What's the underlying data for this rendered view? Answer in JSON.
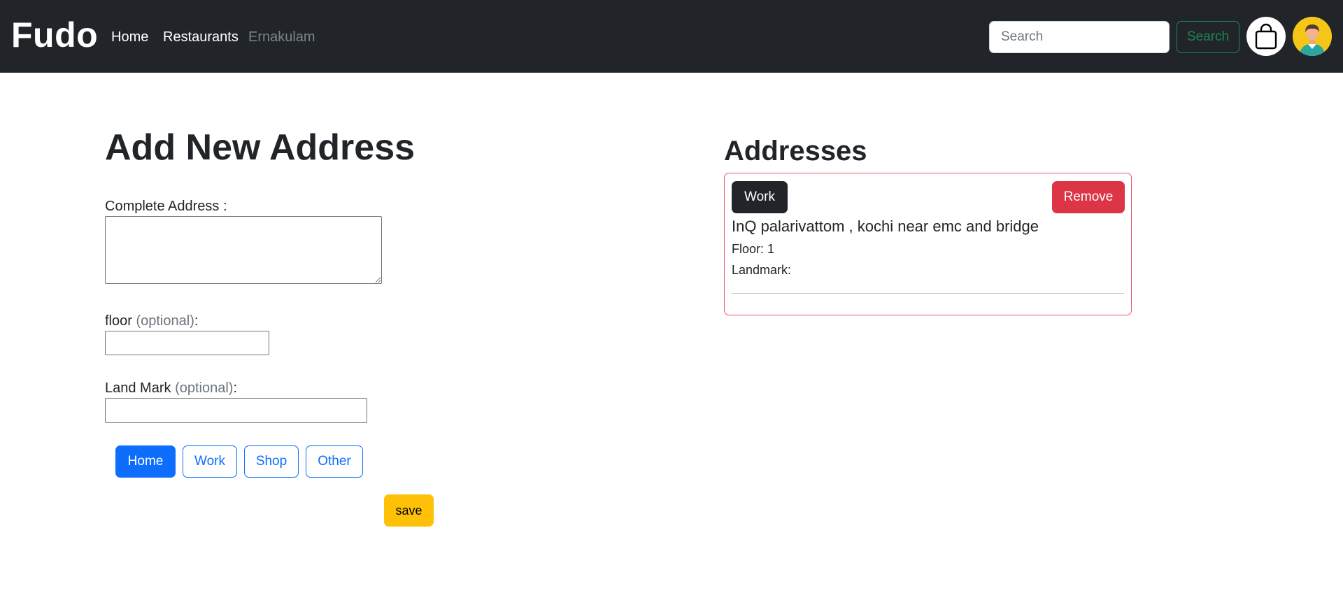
{
  "navbar": {
    "brand": "Fudo",
    "links": {
      "home": "Home",
      "restaurants": "Restaurants",
      "city": "Ernakulam"
    },
    "search": {
      "placeholder": "Search",
      "value": "",
      "button_label": "Search"
    },
    "cart_icon": "shopping-bag-icon",
    "avatar_icon": "user-avatar-icon"
  },
  "form": {
    "title": "Add New Address",
    "complete_address": {
      "label": "Complete Address :",
      "value": ""
    },
    "floor": {
      "label": "floor",
      "optional_label": "(optional)",
      "suffix": ":",
      "value": ""
    },
    "landmark": {
      "label": "Land Mark",
      "optional_label": "(optional)",
      "suffix": ":",
      "value": ""
    },
    "address_types": [
      "Home",
      "Work",
      "Shop",
      "Other"
    ],
    "selected_type": "Home",
    "save_label": "save"
  },
  "addresses": {
    "title": "Addresses",
    "items": [
      {
        "type": "Work",
        "address": "InQ palarivattom , kochi near emc and bridge",
        "floor": "Floor: 1",
        "landmark": "Landmark:",
        "remove_label": "Remove"
      }
    ]
  },
  "colors": {
    "navbar_bg": "#212529",
    "primary": "#0d6efd",
    "success": "#198754",
    "danger": "#dc3545",
    "warning": "#ffc107",
    "dark": "#212529",
    "card_border": "#e35d6a"
  }
}
